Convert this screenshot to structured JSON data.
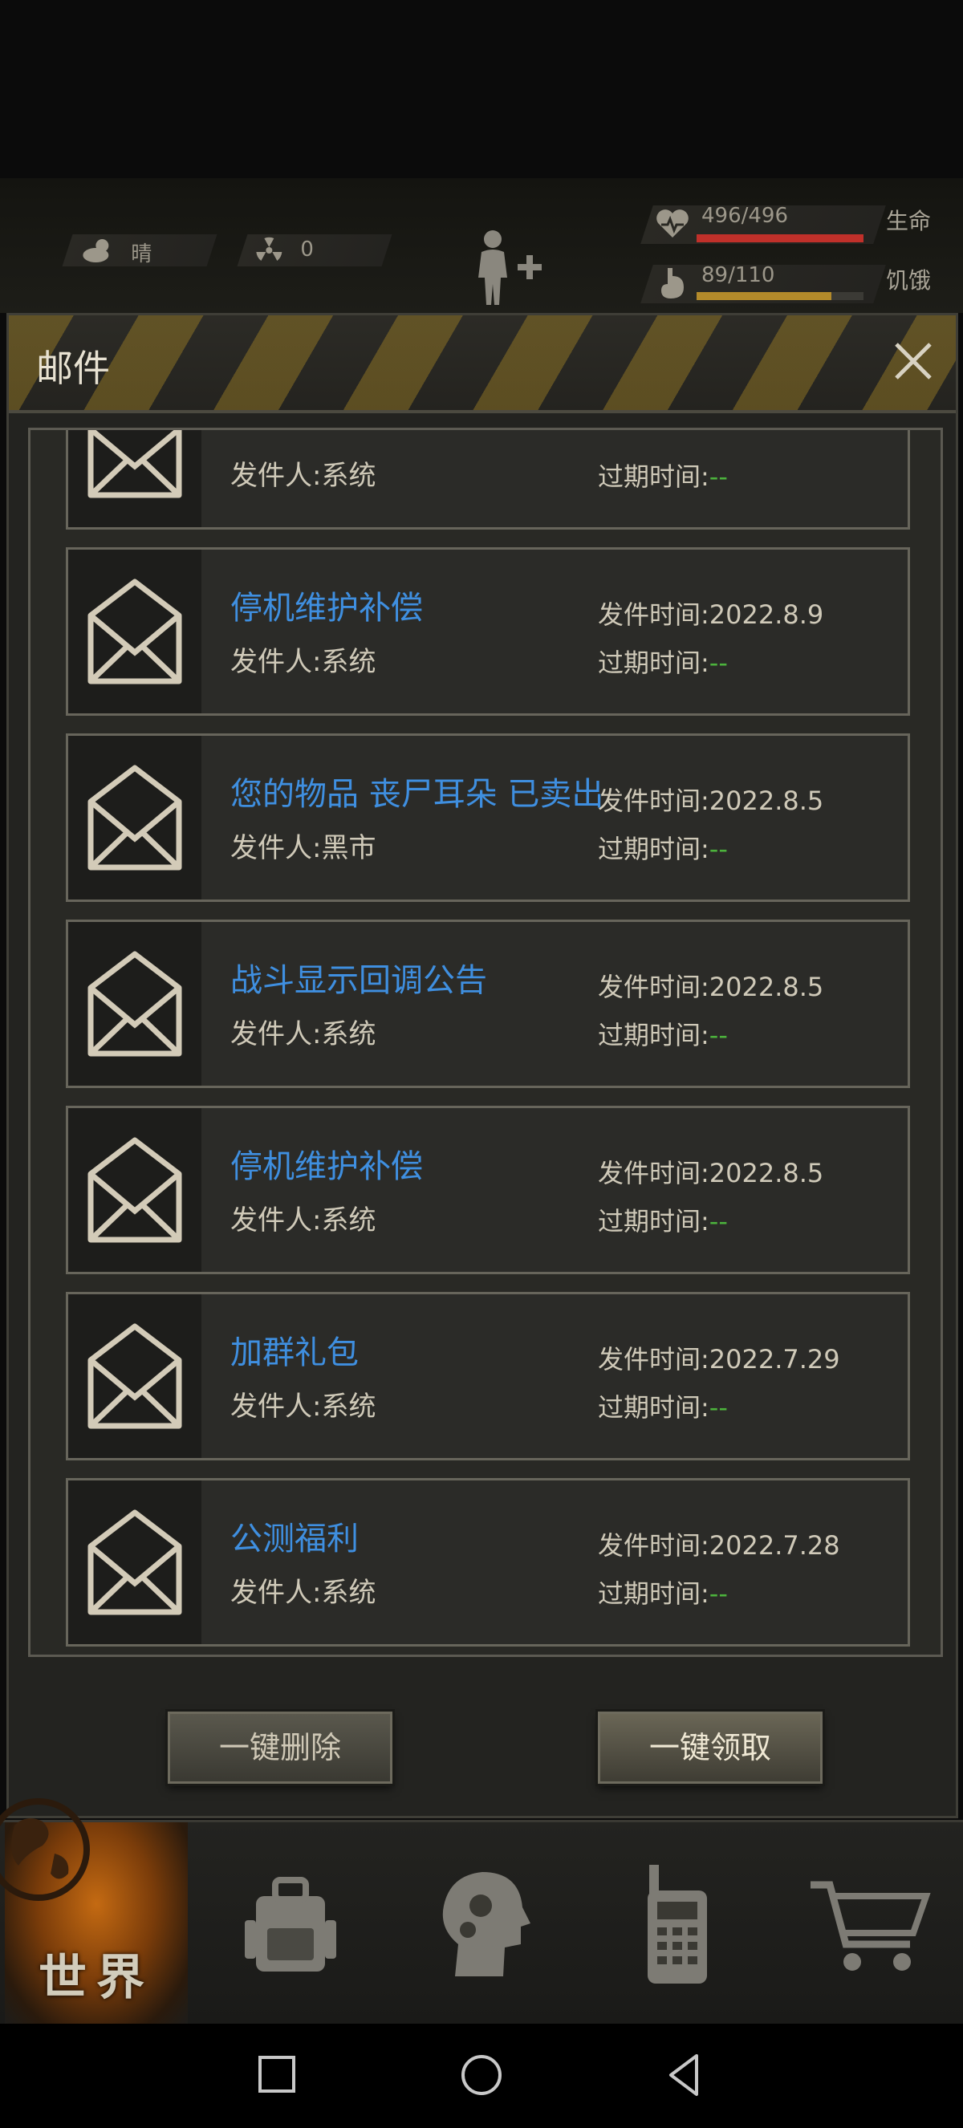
{
  "status": {
    "weather": "晴",
    "radiation": "0",
    "health_value": "496/496",
    "health_label": "生命",
    "health_fraction": 1.0,
    "hunger_value": "89/110",
    "hunger_label": "饥饿",
    "hunger_fraction": 0.81
  },
  "panel": {
    "title": "邮件"
  },
  "mails": [
    {
      "title": "",
      "sender": "发件人:系统",
      "sent": "",
      "expire_label": "过期时间:",
      "expire_value": "--"
    },
    {
      "title": "停机维护补偿",
      "sender": "发件人:系统",
      "sent": "发件时间:2022.8.9",
      "expire_label": "过期时间:",
      "expire_value": "--"
    },
    {
      "title": "您的物品 丧尸耳朵 已卖出",
      "sender": "发件人:黑市",
      "sent": "发件时间:2022.8.5",
      "expire_label": "过期时间:",
      "expire_value": "--"
    },
    {
      "title": "战斗显示回调公告",
      "sender": "发件人:系统",
      "sent": "发件时间:2022.8.5",
      "expire_label": "过期时间:",
      "expire_value": "--"
    },
    {
      "title": "停机维护补偿",
      "sender": "发件人:系统",
      "sent": "发件时间:2022.8.5",
      "expire_label": "过期时间:",
      "expire_value": "--"
    },
    {
      "title": "加群礼包",
      "sender": "发件人:系统",
      "sent": "发件时间:2022.7.29",
      "expire_label": "过期时间:",
      "expire_value": "--"
    },
    {
      "title": "公测福利",
      "sender": "发件人:系统",
      "sent": "发件时间:2022.7.28",
      "expire_label": "过期时间:",
      "expire_value": "--"
    }
  ],
  "actions": {
    "delete_all": "一键删除",
    "claim_all": "一键领取"
  },
  "nav": {
    "world_label": "世界"
  },
  "colors": {
    "title_blue": "#3f8fe0",
    "expire_green": "#4cb33c",
    "health_red": "#c0302a",
    "hunger_gold": "#b38a2a"
  }
}
